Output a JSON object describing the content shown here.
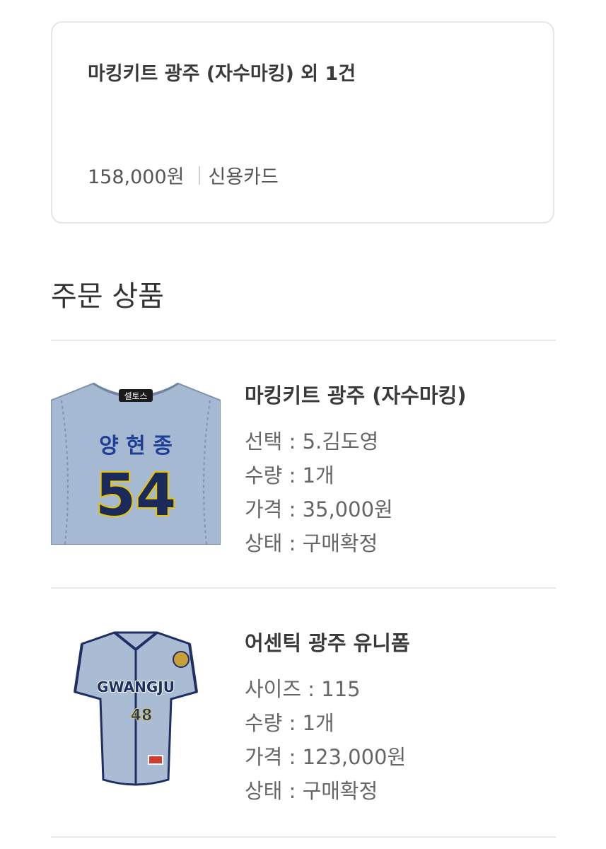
{
  "summary": {
    "title": "마킹키트 광주 (자수마킹) 외 1건",
    "price": "158,000원",
    "payment_method": "신용카드"
  },
  "section": {
    "title": "주문 상품"
  },
  "products": [
    {
      "name": "마킹키트 광주 (자수마킹)",
      "image": {
        "icon": "marking-kit-jersey-image",
        "patch_text": "셀토스",
        "player_name": "양 현 종",
        "number": "54",
        "jersey_color": "#a5b9d2",
        "number_color": "#1b2a5a",
        "number_outline": "#e9c400"
      },
      "details": [
        "선택 : 5.김도영",
        "수량 : 1개",
        "가격 : 35,000원",
        "상태 : 구매확정"
      ]
    },
    {
      "name": "어센틱 광주 유니폼",
      "image": {
        "icon": "authentic-uniform-jersey-image",
        "team_text": "GWANGJU",
        "number": "48",
        "jersey_color": "#a9bcd4",
        "trim_color": "#1f2f63"
      },
      "details": [
        "사이즈 : 115",
        "수량 : 1개",
        "가격 : 123,000원",
        "상태 : 구매확정"
      ]
    }
  ]
}
